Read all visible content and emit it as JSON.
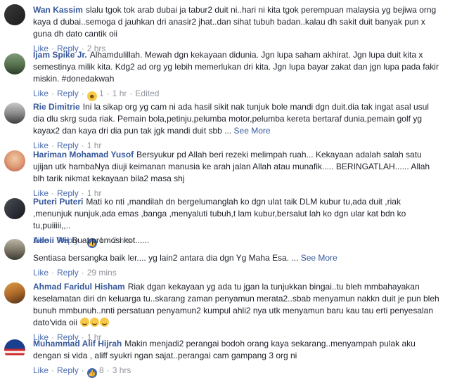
{
  "comments": [
    {
      "author": "Wan Kassim",
      "text": "slalu tgok tok arab dubai ja tabur2 duit ni..hari ni kita tgok perempuan malaysia yg bejiwa orng kaya d dubai..semoga d jauhkan dri anasir2 jhat..dan sihat tubuh badan..kalau dh sakit duit banyak pun x guna dh dato cantik oii",
      "see_more": "",
      "like": "Like",
      "reply": "Reply",
      "reaction_count": "",
      "time": "2 hrs",
      "edited": ""
    },
    {
      "author": "Ijam Spike Jr.",
      "text": "Alhamdulillah. Mewah dgn kekayaan didunia. Jgn lupa saham akhirat. Jgn lupa duit kita x semestinya milik kita. Kdg2 ad org yg lebih memerlukan dri kita. Jgn lupa bayar zakat dan jgn lupa pada fakir miskin. #donedakwah",
      "see_more": "",
      "like": "Like",
      "reply": "Reply",
      "reaction_count": "1",
      "time": "1 hr",
      "edited": "Edited"
    },
    {
      "author": "Rie Dimitrie",
      "text": "Ini la sikap org yg cam ni ada hasil sikit nak tunjuk bole mandi dgn duit.dia tak ingat asal usul dia dlu skrg suda riak. Pemain bola,petinju,pelumba motor,pelumba kereta bertaraf dunia,pemain golf yg kayax2 dan kaya dri dia pun tak jgk mandi duit sbb ...",
      "see_more": "See More",
      "like": "Like",
      "reply": "Reply",
      "reaction_count": "",
      "time": "1 hr",
      "edited": ""
    },
    {
      "author": "Hariman Mohamad Yusof",
      "text": "Bersyukur pd Allah beri rezeki melimpah ruah... Kekayaan adalah salah satu ujijan utk hambaNya diuji keimanan manusia ke arah jalan Allah atau munafik..... BERINGATLAH...... Allah blh tarik nikmat kekayaan bila2 masa shj",
      "see_more": "",
      "like": "Like",
      "reply": "Reply",
      "reaction_count": "",
      "time": "1 hr",
      "edited": ""
    },
    {
      "author": "Puteri Puteri",
      "text": "Mati ko nti ,mandilah dn bergelumanglah ko dgn ulat taik DLM kubur tu,ada duit ,riak ,menunjuk nunjuk,ada emas ,banga ,menyaluti tubuh,t lam kubur,bersalut lah ko dgn ular kat bdn ko tu,puiiiii,,..",
      "see_more": "",
      "like": "Like",
      "reply": "Reply",
      "reaction_count": "1",
      "time": "2 hrs",
      "edited": ""
    },
    {
      "author": "Adoii Wii",
      "text": "Buat promosi kot......",
      "text2": "Sentiasa bersangka baik ler.... yg lain2 antara dia dgn Yg Maha Esa. ...",
      "see_more": "See More",
      "like": "Like",
      "reply": "Reply",
      "reaction_count": "",
      "time": "29 mins",
      "edited": ""
    },
    {
      "author": "Ahmad Faridul Hisham",
      "text": "Riak dgan kekayaan yg ada tu jgan la tunjukkan bingai..tu bleh mmbahayakan keselamatan diri dn keluarga tu..skarang zaman penyamun merata2..sbab menyamun nakkn duit je pun bleh bunuh mmbunuh..nnti persatuan penyamun2 kumpul ahli2 nya utk menyamun baru kau tau erti penyesalan dato'vida oii",
      "see_more": "",
      "like": "Like",
      "reply": "Reply",
      "reaction_count": "",
      "time": "1 hr",
      "edited": ""
    },
    {
      "author": "Muhammad Alif Hijrah",
      "text": "Makin menjadi2 perangai bodoh orang kaya sekarang..menyampah pulak aku dengan si vida , aliff syukri ngan sajat..perangai cam gampang 3 org ni",
      "see_more": "",
      "like": "Like",
      "reply": "Reply",
      "reaction_count": "8",
      "time": "3 hrs",
      "edited": ""
    }
  ]
}
